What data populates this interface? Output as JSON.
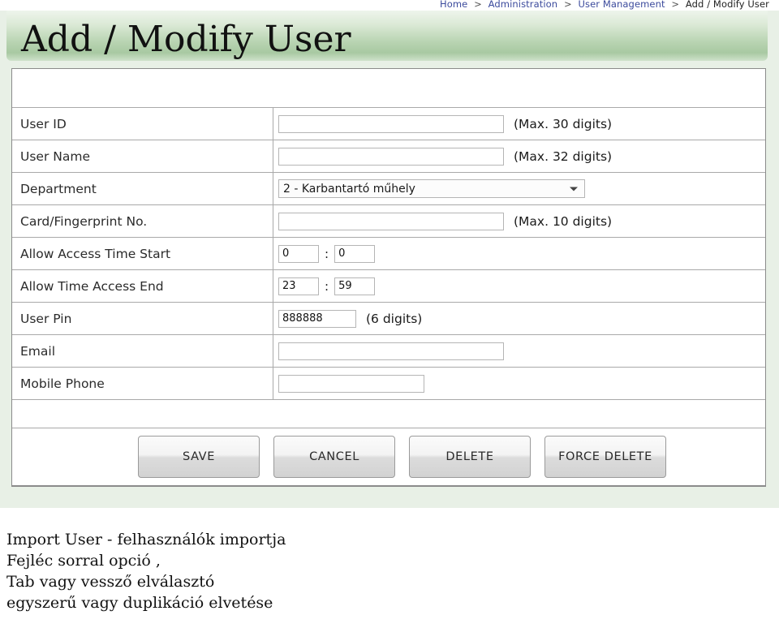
{
  "breadcrumb": {
    "items": [
      "Home",
      "Administration",
      "User Management",
      "Add / Modify User"
    ],
    "separator": ">"
  },
  "header": {
    "title": "Add / Modify User"
  },
  "form": {
    "rows": [
      {
        "label": "User ID",
        "control": "text",
        "value": "",
        "hint": "(Max. 30 digits)"
      },
      {
        "label": "User Name",
        "control": "text",
        "value": "",
        "hint": "(Max. 32 digits)"
      },
      {
        "label": "Department",
        "control": "select",
        "value": "2 - Karbantartó műhely",
        "hint": ""
      },
      {
        "label": "Card/Fingerprint No.",
        "control": "text",
        "value": "",
        "hint": "(Max. 10 digits)"
      },
      {
        "label": "Allow Access Time Start",
        "control": "time",
        "hour": "0",
        "minute": "0",
        "separator": ":",
        "hint": ""
      },
      {
        "label": "Allow Time Access End",
        "control": "time",
        "hour": "23",
        "minute": "59",
        "separator": ":",
        "hint": ""
      },
      {
        "label": "User Pin",
        "control": "text",
        "value": "888888",
        "hint": "(6 digits)"
      },
      {
        "label": "Email",
        "control": "text",
        "value": "",
        "hint": ""
      },
      {
        "label": "Mobile Phone",
        "control": "text",
        "value": "",
        "hint": ""
      }
    ]
  },
  "buttons": {
    "save": "SAVE",
    "cancel": "CANCEL",
    "delete": "DELETE",
    "force_delete": "FORCE DELETE"
  },
  "caption": {
    "line1": "Import User - felhasználók importja",
    "line2": "Fejléc sorral opció ,",
    "line3": "Tab vagy vessző elválasztó",
    "line4": "egyszerű vagy duplikáció elvetése"
  },
  "colors": {
    "header_green": "#b9d4b2",
    "page_background": "#e8f0e6",
    "breadcrumb_link": "#3b4a9c",
    "table_border": "#8b8b8b"
  }
}
